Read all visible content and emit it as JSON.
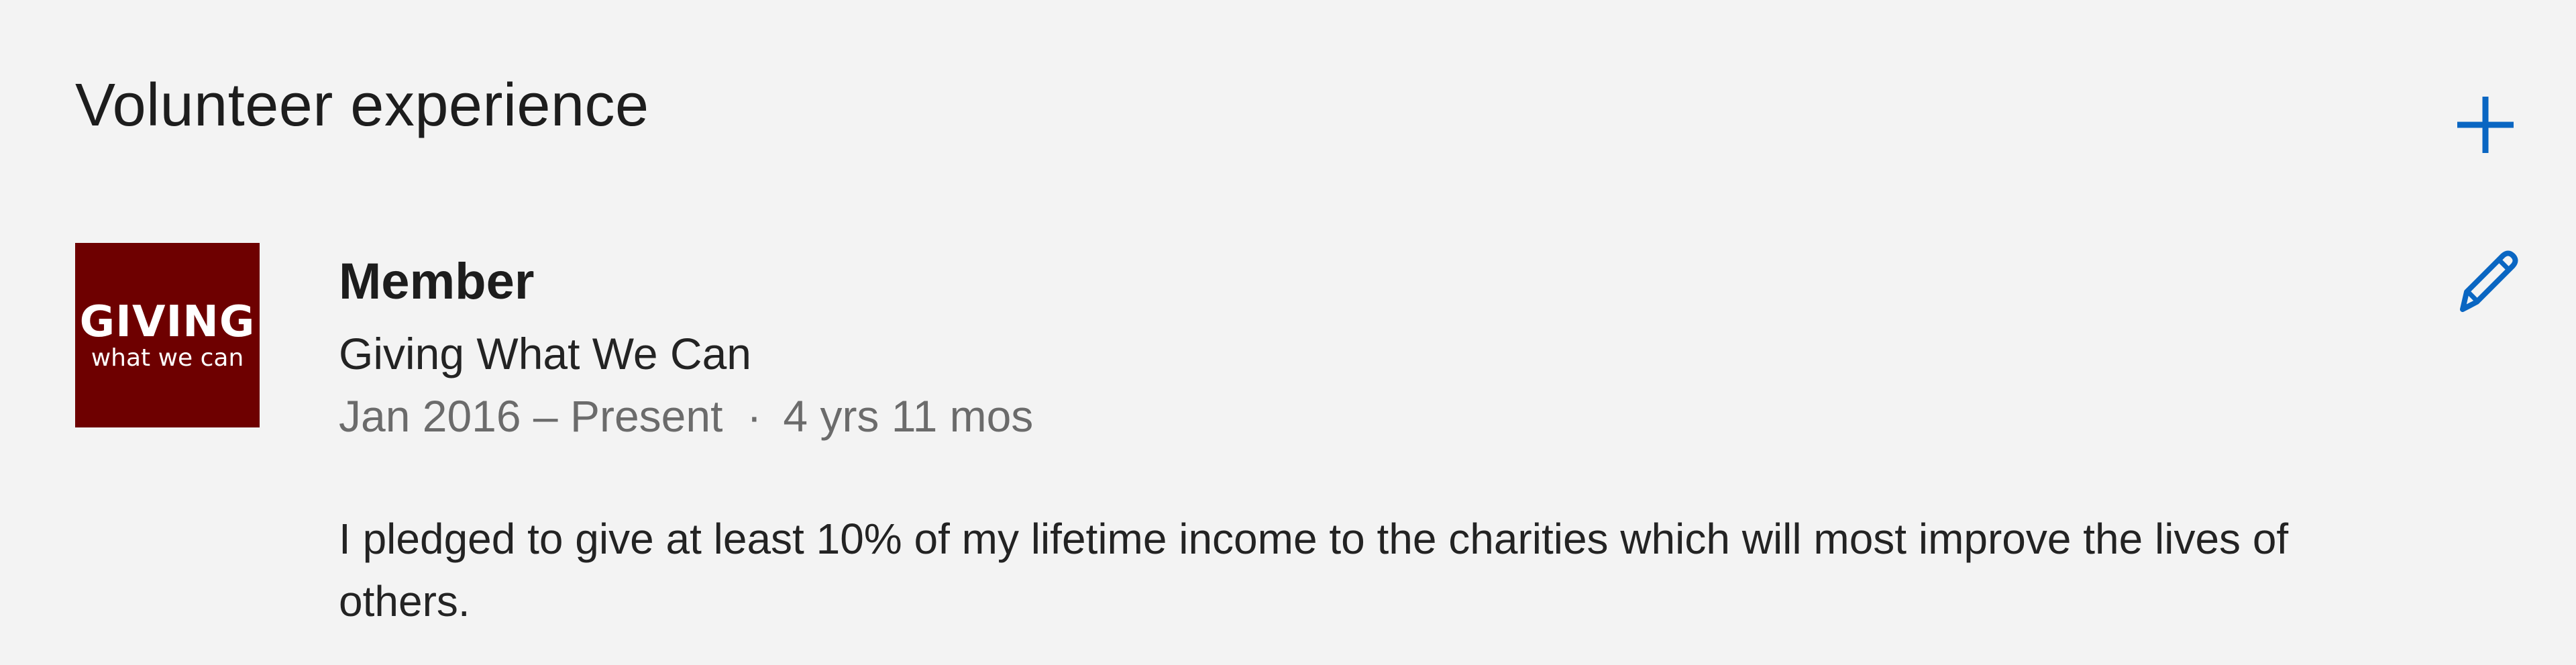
{
  "section": {
    "title": "Volunteer experience"
  },
  "actions": {
    "add_icon": "plus-icon",
    "edit_icon": "pencil-icon",
    "accent_color": "#0a66c2"
  },
  "entry": {
    "logo": {
      "main_text": "GIVING",
      "sub_text": "what we can",
      "background_color": "#6e0000"
    },
    "role": "Member",
    "organization": "Giving What We Can",
    "date_range": "Jan 2016 – Present",
    "separator": "·",
    "duration": "4 yrs 11 mos",
    "description": "I pledged to give at least 10% of my lifetime income to the charities which will most improve the lives of others."
  }
}
